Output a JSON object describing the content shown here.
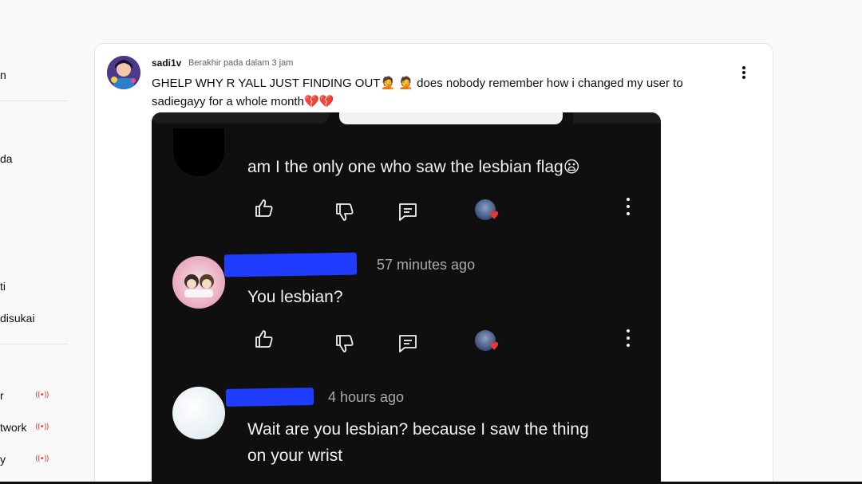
{
  "sidebar": {
    "items": [
      {
        "label": "n"
      },
      {
        "label": "da"
      },
      {
        "label": "ti"
      },
      {
        "label": "disukai"
      },
      {
        "label": "r",
        "live": true
      },
      {
        "label": "twork",
        "live": true
      },
      {
        "label": "y",
        "live": true
      }
    ],
    "live_icon": "((•))"
  },
  "post": {
    "author": "sadi1v",
    "meta": "Berakhir pada dalam 3 jam",
    "text_part1": "GHELP WHY R YALL JUST FINDING OUT",
    "emoji_1": "🤦",
    "text_part2": " does nobody remember how i changed my user to sadiegayy for a whole month",
    "hearts": "💔💔",
    "colors": {
      "accent": "#0f0f0f",
      "live": "#e53935"
    }
  },
  "screenshot": {
    "comment1": {
      "text": "am I the only one who saw the lesbian flag",
      "emoji": "😦"
    },
    "comment2": {
      "time": "57 minutes ago",
      "text": "You lesbian?"
    },
    "comment3": {
      "time": "4 hours ago",
      "line1": "Wait are you lesbian? because I saw the thing",
      "line2": "on your wrist"
    }
  }
}
